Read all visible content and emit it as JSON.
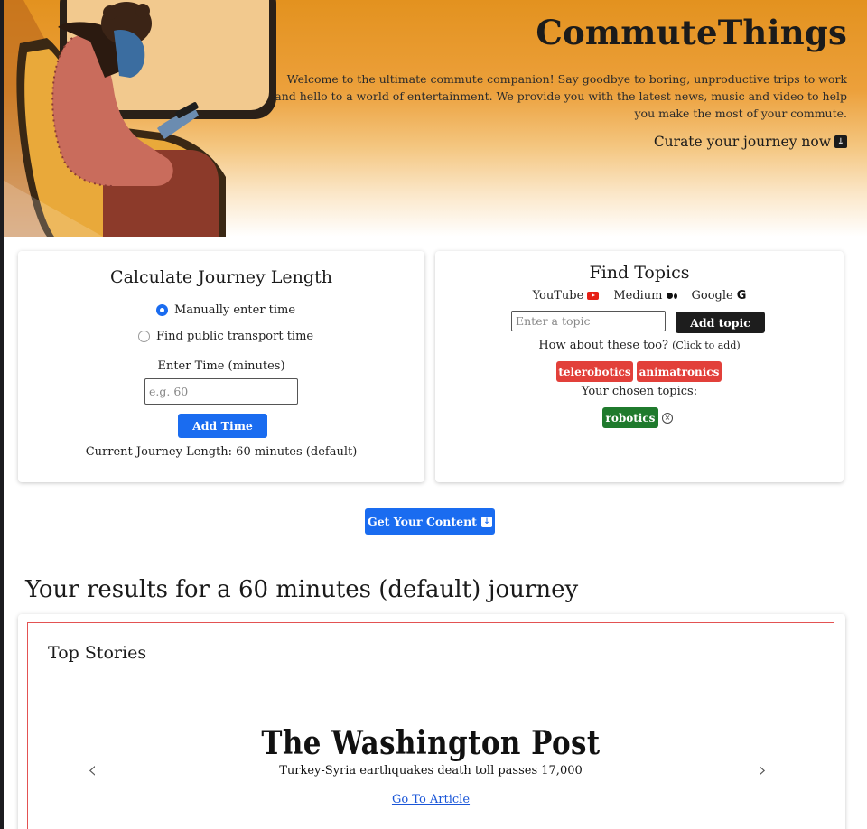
{
  "hero": {
    "title": "CommuteThings",
    "description": "Welcome to the ultimate commute companion! Say goodbye to boring, unproductive trips to work and hello to a world of entertainment. We provide you with the latest news, music and video to help you make the most of your commute.",
    "cta_label": "Curate your journey now",
    "cta_icon": "down-arrow-icon"
  },
  "journey": {
    "title": "Calculate Journey Length",
    "options": [
      "Manually enter time",
      "Find public transport time"
    ],
    "selected_option": "Manually enter time",
    "time_label": "Enter Time (minutes)",
    "time_placeholder": "e.g. 60",
    "time_value": "",
    "add_button": "Add Time",
    "current_length": "Current Journey Length: 60 minutes (default)"
  },
  "topics": {
    "title": "Find Topics",
    "sources": [
      {
        "label": "YouTube",
        "icon": "youtube-icon"
      },
      {
        "label": "Medium",
        "icon": "medium-icon"
      },
      {
        "label": "Google",
        "icon": "google-icon"
      }
    ],
    "topic_placeholder": "Enter a topic",
    "topic_value": "",
    "add_button": "Add topic",
    "suggest_text": "How about these too?",
    "suggest_hint": "(Click to add)",
    "suggestions": [
      "telerobotics",
      "animatronics"
    ],
    "chosen_label": "Your chosen topics:",
    "chosen": [
      "robotics"
    ]
  },
  "get_content_button": "Get Your Content",
  "results": {
    "heading": "Your results for a 60 minutes (default) journey",
    "section": "Top Stories",
    "source_name": "The Washington Post",
    "headline": "Turkey-Syria earthquakes death toll passes 17,000",
    "link": "Go To Article"
  },
  "colors": {
    "accent_blue": "#1a6cf0",
    "chip_red": "#e2403a",
    "chip_green": "#1f7a2d",
    "hero_orange": "#e3921f"
  }
}
